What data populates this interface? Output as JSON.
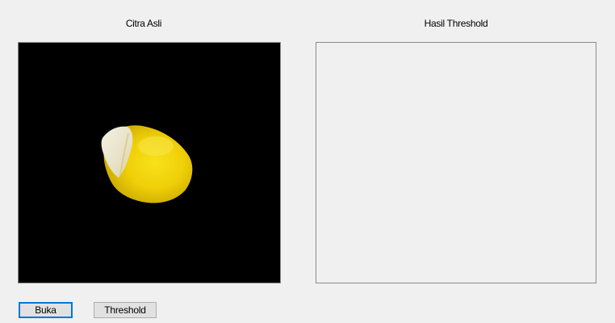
{
  "original_panel": {
    "label": "Citra Asli",
    "image": "corn-kernel-on-black-background"
  },
  "result_panel": {
    "label": "Hasil Threshold",
    "image": ""
  },
  "buttons": {
    "open_label": "Buka",
    "threshold_label": "Threshold"
  },
  "colors": {
    "window_background": "#f0f0f0",
    "image_background": "#000000",
    "kernel_yellow": "#f2d20a",
    "focused_button_border": "#0078d7"
  }
}
